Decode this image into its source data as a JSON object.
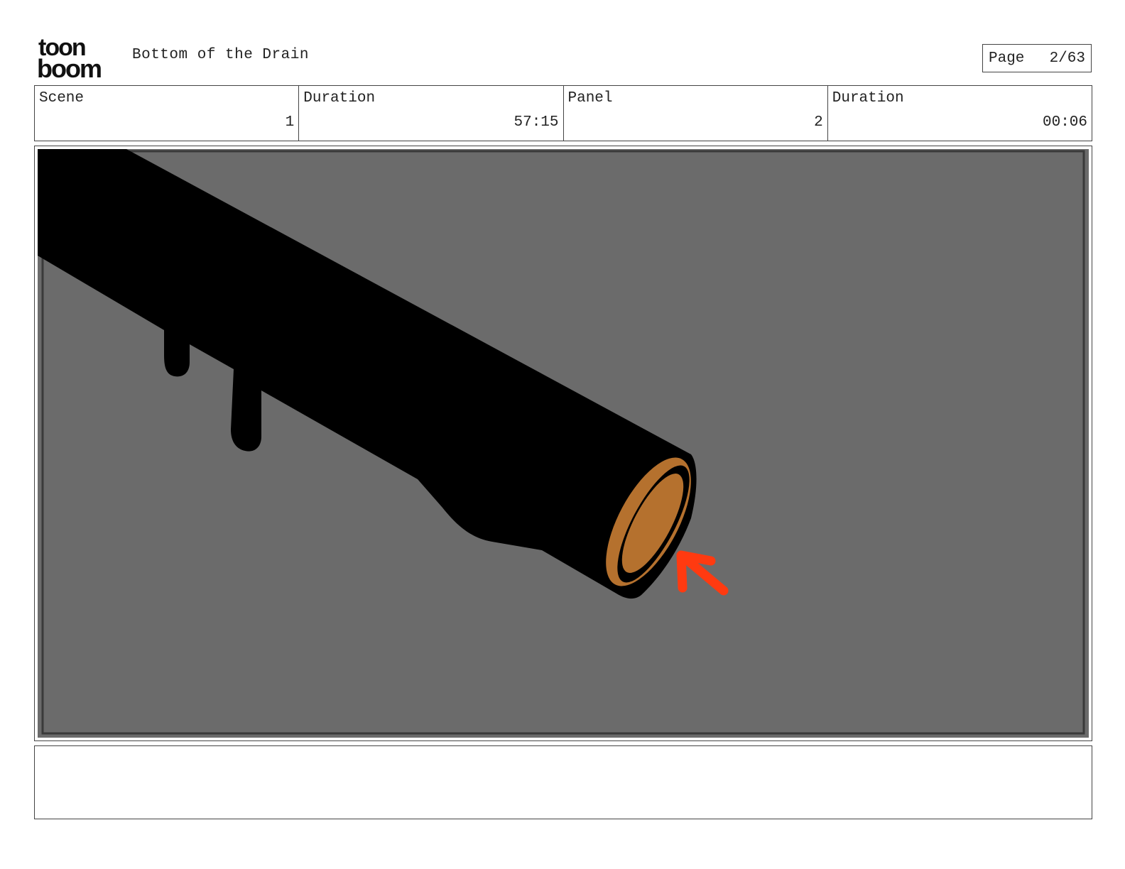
{
  "logo": {
    "text_line1": "toon",
    "text_line2": "boom",
    "icon": "toon-boom-logo"
  },
  "header": {
    "title": "Bottom of the Drain",
    "page_label": "Page",
    "page_value": "2/63"
  },
  "info": {
    "scene_label": "Scene",
    "scene_value": "1",
    "scene_duration_label": "Duration",
    "scene_duration_value": "57:15",
    "panel_label": "Panel",
    "panel_value": "2",
    "panel_duration_label": "Duration",
    "panel_duration_value": "00:06"
  },
  "panel_image": {
    "background_color": "#6b6b6b",
    "pipe_color": "#000000",
    "pipe_opening_color": "#b5712e",
    "arrow_color": "#ff3a10",
    "icons": [
      "drain-pipe-illustration",
      "direction-arrow-icon"
    ]
  },
  "notes": {
    "text": ""
  }
}
